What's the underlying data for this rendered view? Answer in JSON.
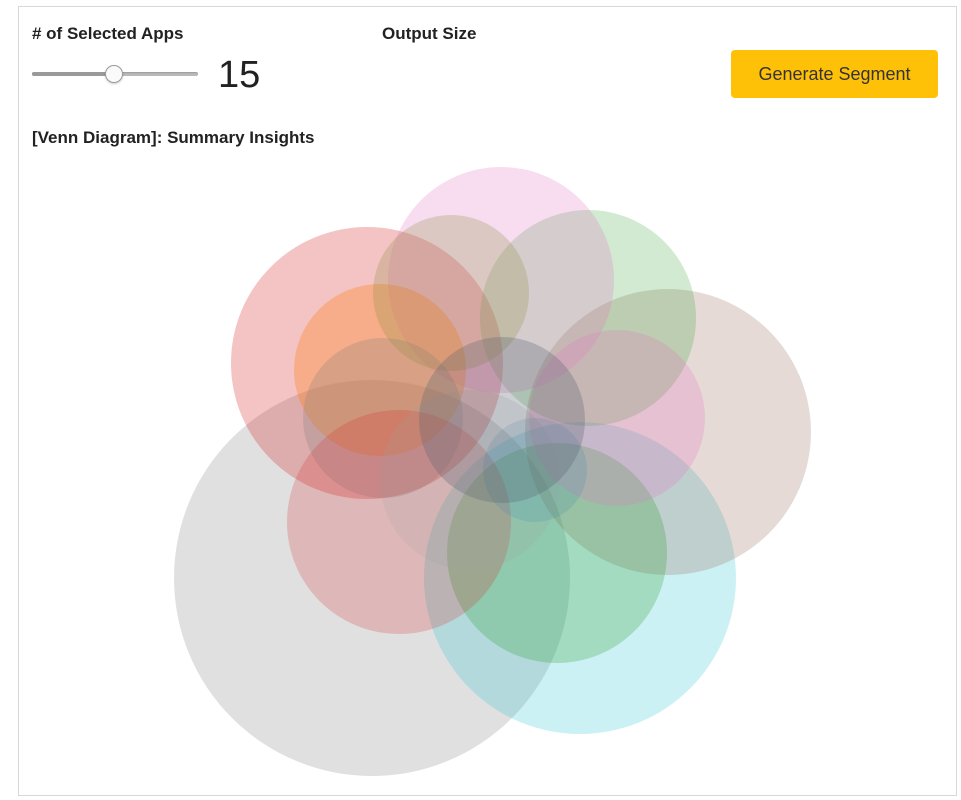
{
  "controls": {
    "apps_label": "# of Selected Apps",
    "output_label": "Output Size",
    "slider": {
      "min": 0,
      "max": 30,
      "value": 15
    },
    "value_display": "15",
    "generate_label": "Generate Segment",
    "generate_color": "#ffc107"
  },
  "venn": {
    "title": "[Venn Diagram]: Summary Insights",
    "sets": [
      {
        "color": "#9e9e9e",
        "opacity": 0.32
      },
      {
        "color": "#17becf",
        "opacity": 0.22
      },
      {
        "color": "#8c564b",
        "opacity": 0.22
      },
      {
        "color": "#d62728",
        "opacity": 0.28
      },
      {
        "color": "#2ca02c",
        "opacity": 0.22
      },
      {
        "color": "#e377c2",
        "opacity": 0.25
      },
      {
        "color": "#2ca02c",
        "opacity": 0.26
      },
      {
        "color": "#ff7f0e",
        "opacity": 0.32
      },
      {
        "color": "#e377c2",
        "opacity": 0.25
      },
      {
        "color": "#7f7f7f",
        "opacity": 0.26
      },
      {
        "color": "#8c8c3c",
        "opacity": 0.26
      },
      {
        "color": "#d62728",
        "opacity": 0.22
      },
      {
        "color": "#9e9e9e",
        "opacity": 0.18
      },
      {
        "color": "#1f77b4",
        "opacity": 0.14
      },
      {
        "color": "#5a6472",
        "opacity": 0.3
      }
    ]
  }
}
